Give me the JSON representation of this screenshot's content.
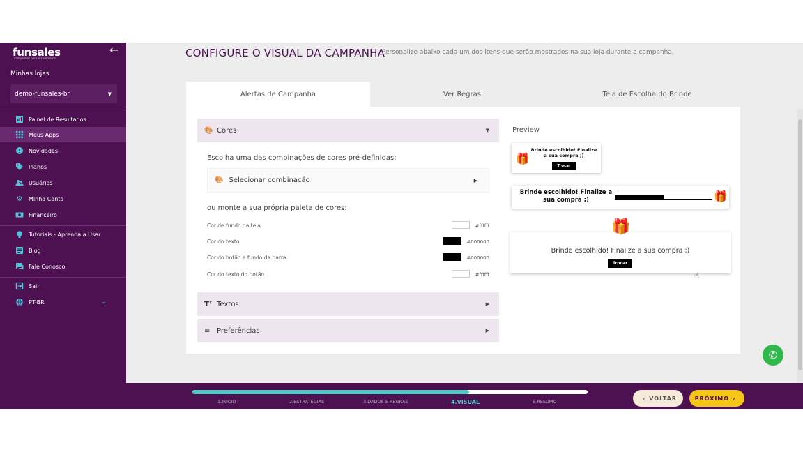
{
  "sidebar": {
    "logo": "funsales",
    "logo_tagline": "campanhas para e-commerce",
    "back_icon": "arrow-left-icon",
    "my_stores_label": "Minhas lojas",
    "store_selected": "demo-funsales-br",
    "items": [
      {
        "label": "Painel de Resultados",
        "icon": "chart-board-icon"
      },
      {
        "label": "Meus Apps",
        "icon": "grid-icon"
      },
      {
        "label": "Novidades",
        "icon": "bell-badge-icon"
      },
      {
        "label": "Planos",
        "icon": "tag-icon"
      },
      {
        "label": "Usuários",
        "icon": "users-icon"
      },
      {
        "label": "Minha Conta",
        "icon": "gear-icon"
      },
      {
        "label": "Financeiro",
        "icon": "money-icon"
      },
      {
        "label": "Tutoriais - Aprenda a Usar",
        "icon": "lightbulb-icon"
      },
      {
        "label": "Blog",
        "icon": "blog-icon"
      },
      {
        "label": "Fale Conosco",
        "icon": "chat-icon"
      },
      {
        "label": "Sair",
        "icon": "logout-icon"
      },
      {
        "label": "PT-BR",
        "icon": "globe-icon"
      }
    ],
    "accent": "#4fc3d8",
    "background": "#4d1152"
  },
  "header": {
    "title": "CONFIGURE O VISUAL DA CAMPANHA",
    "subtitle": "Personalize abaixo cada um dos itens que serão mostrados na sua loja durante a campanha."
  },
  "tabs": [
    {
      "label": "Alertas de Campanha",
      "active": true
    },
    {
      "label": "Ver Regras",
      "active": false
    },
    {
      "label": "Tela de Escolha do Brinde",
      "active": false
    }
  ],
  "sections": {
    "cores": {
      "title": "Cores",
      "hint": "Escolha uma das combinações de cores pré-definidas:",
      "combo_label": "Selecionar combinação",
      "own_palette": "ou monte a sua própria paleta de cores:",
      "rows": [
        {
          "label": "Cor de fundo da tela",
          "hex": "#ffffff",
          "swatch": "#ffffff"
        },
        {
          "label": "Cor do texto",
          "hex": "#000000",
          "swatch": "#000000"
        },
        {
          "label": "Cor do botão e fundo da barra",
          "hex": "#000000",
          "swatch": "#000000"
        },
        {
          "label": "Cor do texto do botão",
          "hex": "#ffffff",
          "swatch": "#ffffff"
        }
      ]
    },
    "textos": {
      "title": "Textos"
    },
    "preferencias": {
      "title": "Preferências"
    }
  },
  "preview": {
    "label": "Preview",
    "small_text": "Brinde escolhido! Finalize a sua compra ;)",
    "small_button": "Trocar",
    "bar_text": "Brinde escolhido! Finalize a sua compra ;)",
    "bar_progress_fraction": 0.5,
    "large_text": "Brinde escolhido! Finalize a sua compra ;)",
    "large_button": "Trocar"
  },
  "footer": {
    "progress_fraction": 0.7,
    "steps": [
      "1.INICIO",
      "2.ESTRATÉGIAS",
      "3.DADOS E REGRAS",
      "4.VISUAL",
      "5.RESUMO"
    ],
    "active_step": 3,
    "back_label": "VOLTAR",
    "next_label": "PRÓXIMO",
    "next_color": "#f5c518",
    "progress_color": "#4ec8c2"
  }
}
